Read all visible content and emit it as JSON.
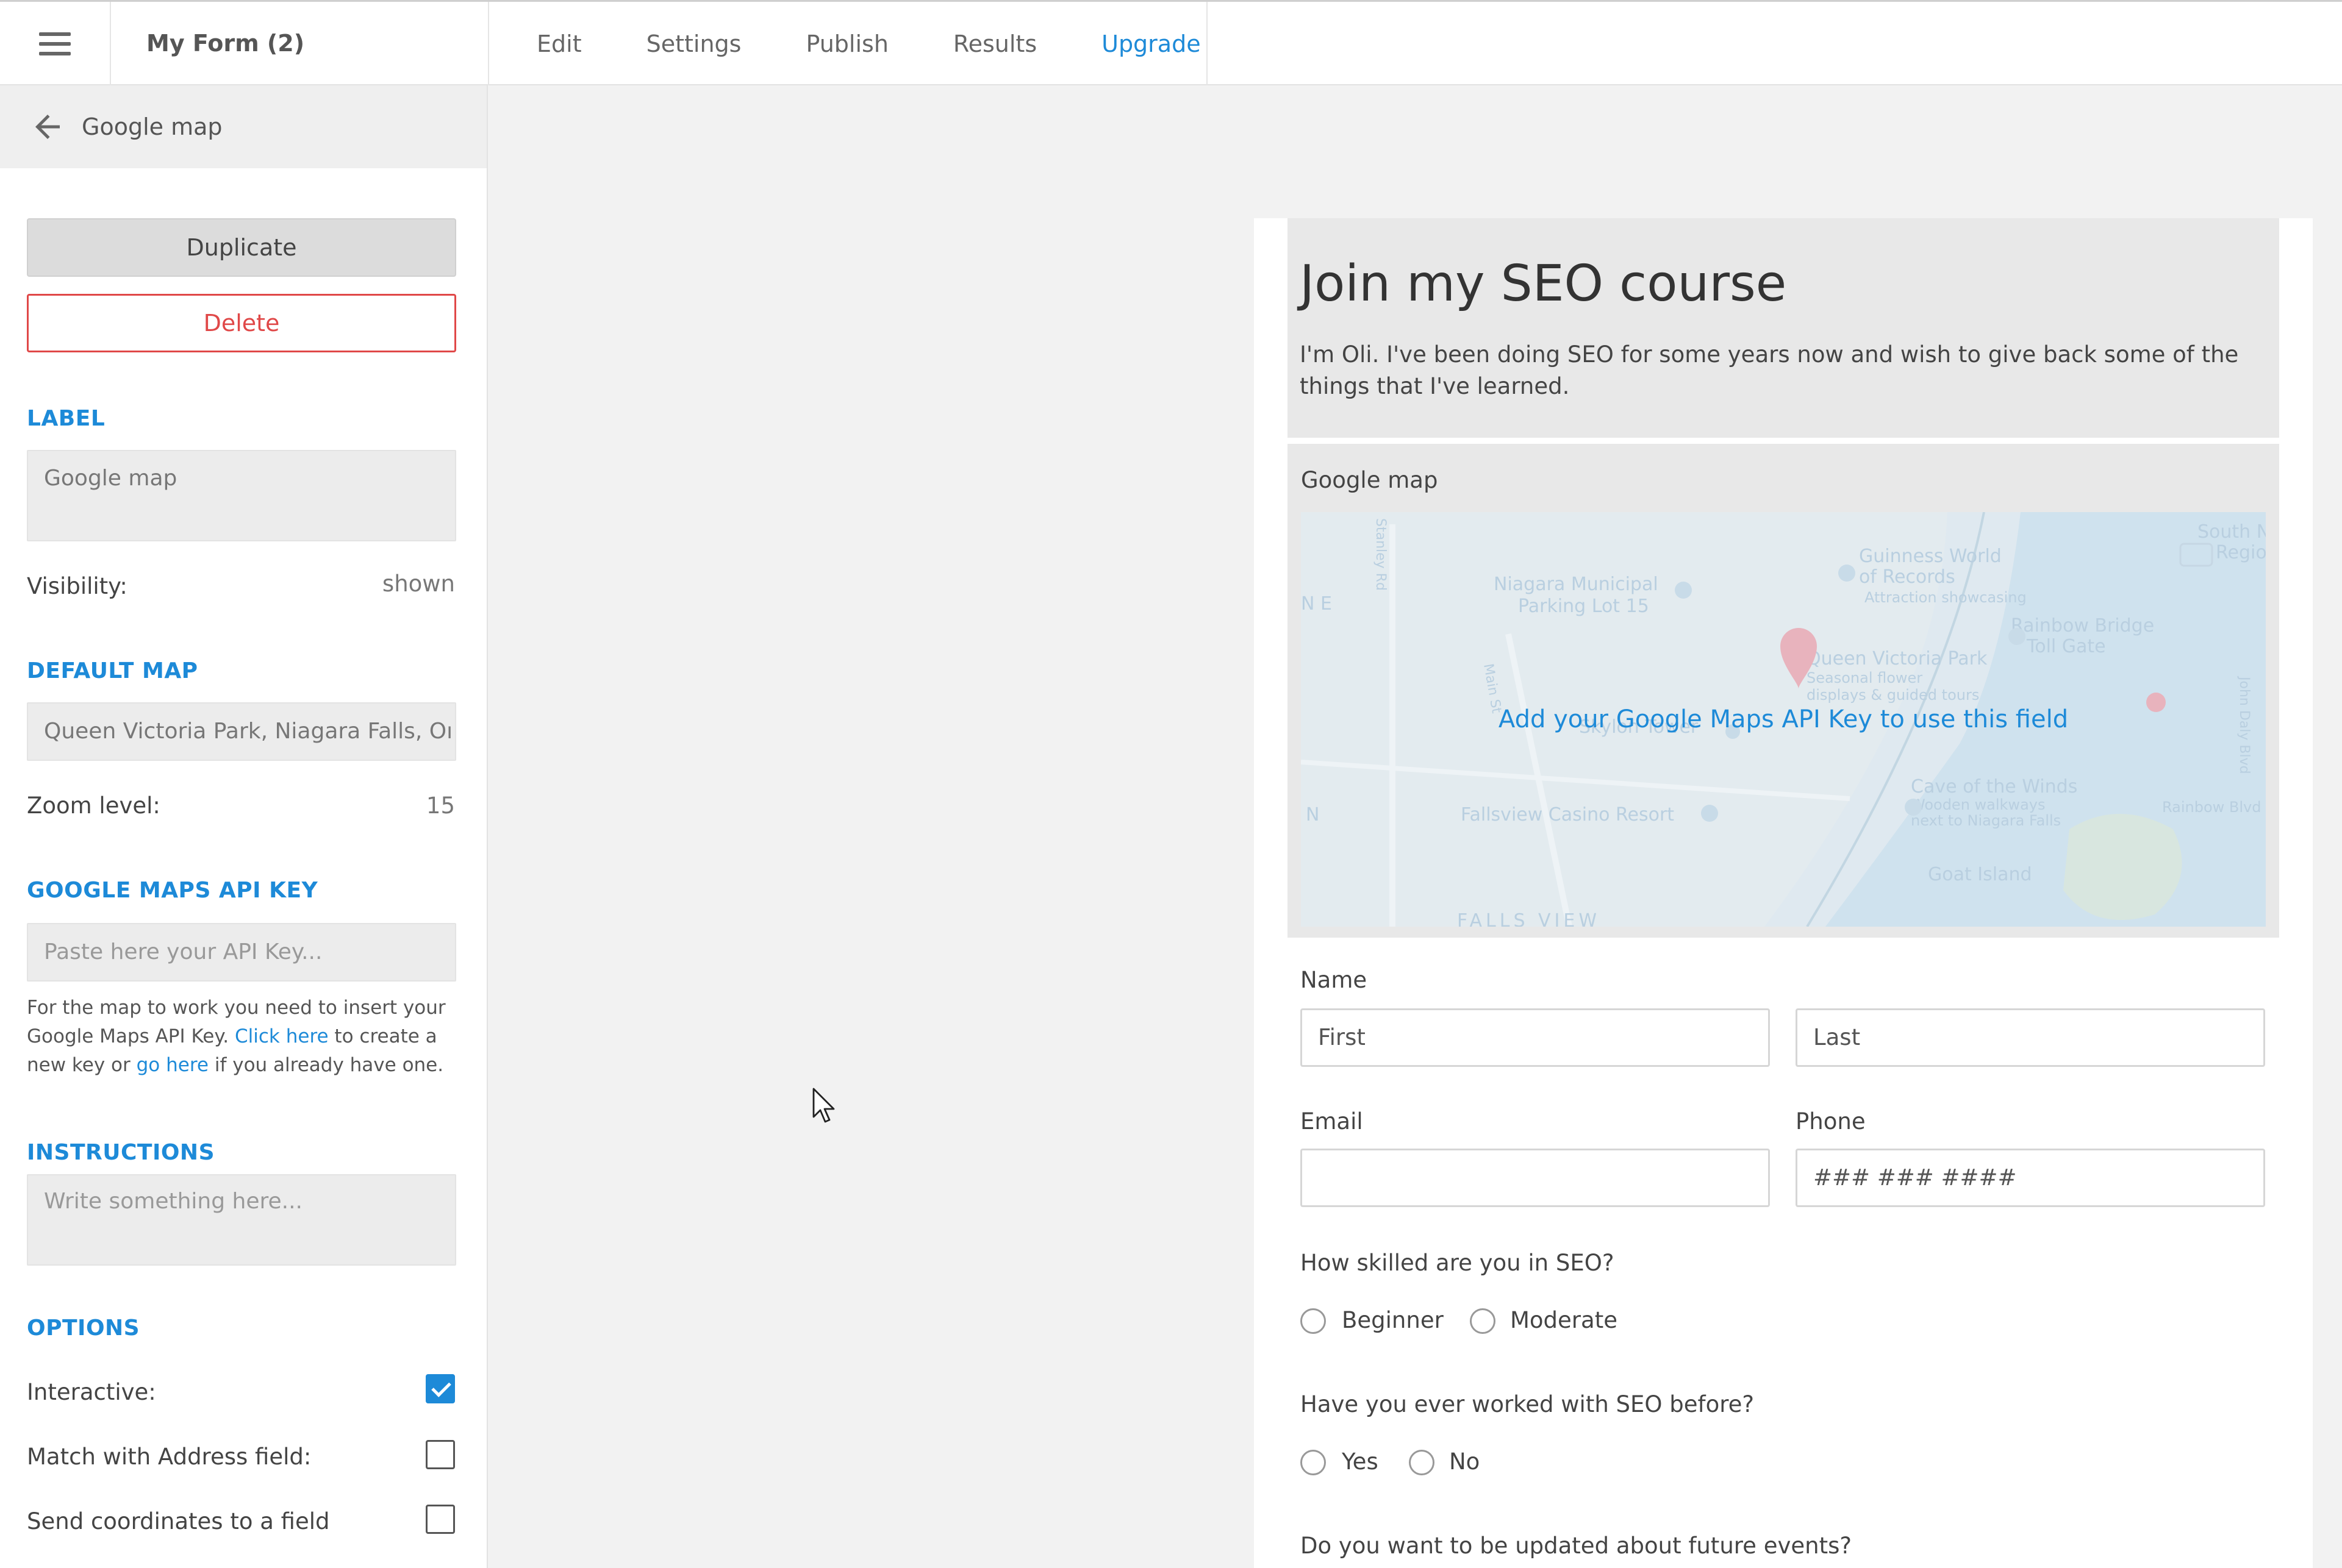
{
  "topbar": {
    "form_title": "My Form (2)",
    "nav": [
      "Edit",
      "Settings",
      "Publish",
      "Results",
      "Upgrade"
    ]
  },
  "panel": {
    "crumb": "Google map",
    "duplicate_label": "Duplicate",
    "delete_label": "Delete",
    "label_heading": "LABEL",
    "label_value": "Google map",
    "visibility_label": "Visibility:",
    "visibility_value": "shown",
    "default_map_heading": "DEFAULT MAP",
    "default_map_value": "Queen Victoria Park, Niagara Falls, Oı",
    "zoom_label": "Zoom level:",
    "zoom_value": "15",
    "api_heading": "GOOGLE MAPS API KEY",
    "api_placeholder": "Paste here your API Key...",
    "help_1": "For the map to work you need to insert your Google Maps API Key. ",
    "help_link_1": "Click here",
    "help_2": " to create a new key or ",
    "help_link_2": "go here",
    "help_3": " if you already have one.",
    "instructions_heading": "INSTRUCTIONS",
    "instructions_placeholder": "Write something here...",
    "options_heading": "OPTIONS",
    "options": [
      {
        "label": "Interactive:",
        "checked": true
      },
      {
        "label": "Match with Address field:",
        "checked": false
      },
      {
        "label": "Send coordinates to a field",
        "checked": false
      }
    ]
  },
  "form": {
    "title": "Join my SEO course",
    "description": "I'm Oli. I've been doing SEO for some years now and wish to give back some of the things that I've learned.",
    "map_label": "Google map",
    "map_cta": "Add your Google Maps API Key to use this field",
    "map_places": [
      "Niagara Municipal Parking Lot 15",
      "Guinness World of Records",
      "Attraction showcasing",
      "Rainbow Bridge Toll Gate",
      "Queen Victoria Park",
      "Seasonal flower",
      "displays & guided tours",
      "Skylon Tower",
      "Cave of the Winds",
      "Wooden walkways",
      "next to Niagara Falls",
      "Fallsview Casino Resort",
      "Goat Island",
      "FALLS VIEW",
      "South Ni",
      "Regio",
      "Rainbow Blvd",
      "John Daly Blvd",
      "Main St",
      "Stanley Rd"
    ],
    "name_label": "Name",
    "first_placeholder": "First",
    "last_placeholder": "Last",
    "email_label": "Email",
    "phone_label": "Phone",
    "phone_placeholder": "### ### ####",
    "q1": "How skilled are you in SEO?",
    "q1_options": [
      "Beginner",
      "Moderate"
    ],
    "q2": "Have you ever worked with SEO before?",
    "q2_options": [
      "Yes",
      "No"
    ],
    "q3": "Do you want to be updated about future events?"
  },
  "colors": {
    "accent": "#1d8ad8",
    "danger": "#e04848"
  }
}
